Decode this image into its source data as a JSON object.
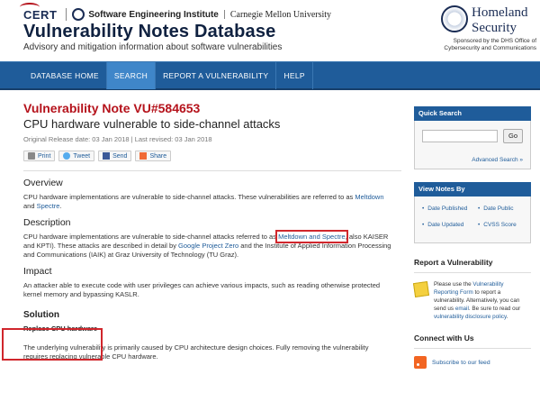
{
  "header": {
    "cert_logo": "CERT",
    "institute": "Software Engineering Institute",
    "university": "Carnegie Mellon University",
    "site_title": "Vulnerability Notes Database",
    "tagline": "Advisory and mitigation information about software vulnerabilities",
    "dhs_line1": "Homeland",
    "dhs_line2": "Security",
    "dhs_sponsor": "Sponsored by the DHS Office of Cybersecurity and Communications"
  },
  "nav": {
    "items": [
      {
        "label": "DATABASE HOME"
      },
      {
        "label": "SEARCH"
      },
      {
        "label": "REPORT A VULNERABILITY"
      },
      {
        "label": "HELP"
      }
    ],
    "active": "SEARCH"
  },
  "note": {
    "title": "Vulnerability Note VU#584653",
    "subtitle": "CPU hardware vulnerable to side-channel attacks",
    "dates": "Original Release date: 03 Jan 2018 | Last revised: 03 Jan 2018",
    "share": {
      "print": "Print",
      "tweet": "Tweet",
      "send": "Send",
      "share": "Share"
    }
  },
  "overview": {
    "heading": "Overview",
    "text_1": "CPU hardware implementations are vulnerable to side-channel attacks. These vulnerabilities are referred to as",
    "link_meltdown": "Meltdown",
    "and": "and",
    "link_spectre": "Spectre",
    "end": "."
  },
  "description": {
    "heading": "Description",
    "text_1": "CPU hardware implementations are vulnerable to side-channel attacks referred to as",
    "link_meltdown_spectre": "Meltdown and Spectre",
    "text_2": ", also KAISER and KPTI). These attacks are described in detail by",
    "link_gpz": "Google Project Zero",
    "text_3": "and the Institute of Applied Information Processing and Communications (IAIK) at Graz University of Technology (TU Graz)."
  },
  "impact": {
    "heading": "Impact",
    "text": "An attacker able to execute code with user privileges can achieve various impacts, such as reading otherwise protected kernel memory and bypassing KASLR."
  },
  "solution": {
    "heading": "Solution",
    "subheading": "Replace CPU hardware",
    "text": "The underlying vulnerability is primarily caused by CPU architecture design choices. Fully removing the vulnerability requires replacing vulnerable CPU hardware."
  },
  "sidebar": {
    "quick_search": {
      "heading": "Quick Search",
      "placeholder": "",
      "go": "Go",
      "advanced": "Advanced Search »"
    },
    "view_notes": {
      "heading": "View Notes By",
      "links": [
        "Date Published",
        "Date Public",
        "Date Updated",
        "CVSS Score"
      ]
    },
    "report": {
      "heading": "Report a Vulnerability",
      "text_1": "Please use the",
      "link_form": "Vulnerability Reporting Form",
      "text_2": "to report a vulnerability. Alternatively, you can send us",
      "link_email": "email",
      "text_3": ". Be sure to read our",
      "link_policy": "vulnerability disclosure policy",
      "text_4": "."
    },
    "connect": {
      "heading": "Connect with Us",
      "rss": "Subscribe to our feed"
    }
  },
  "colors": {
    "accent_red": "#b5121b",
    "nav_blue": "#1f5c9a",
    "highlight_red": "#d0262c"
  }
}
